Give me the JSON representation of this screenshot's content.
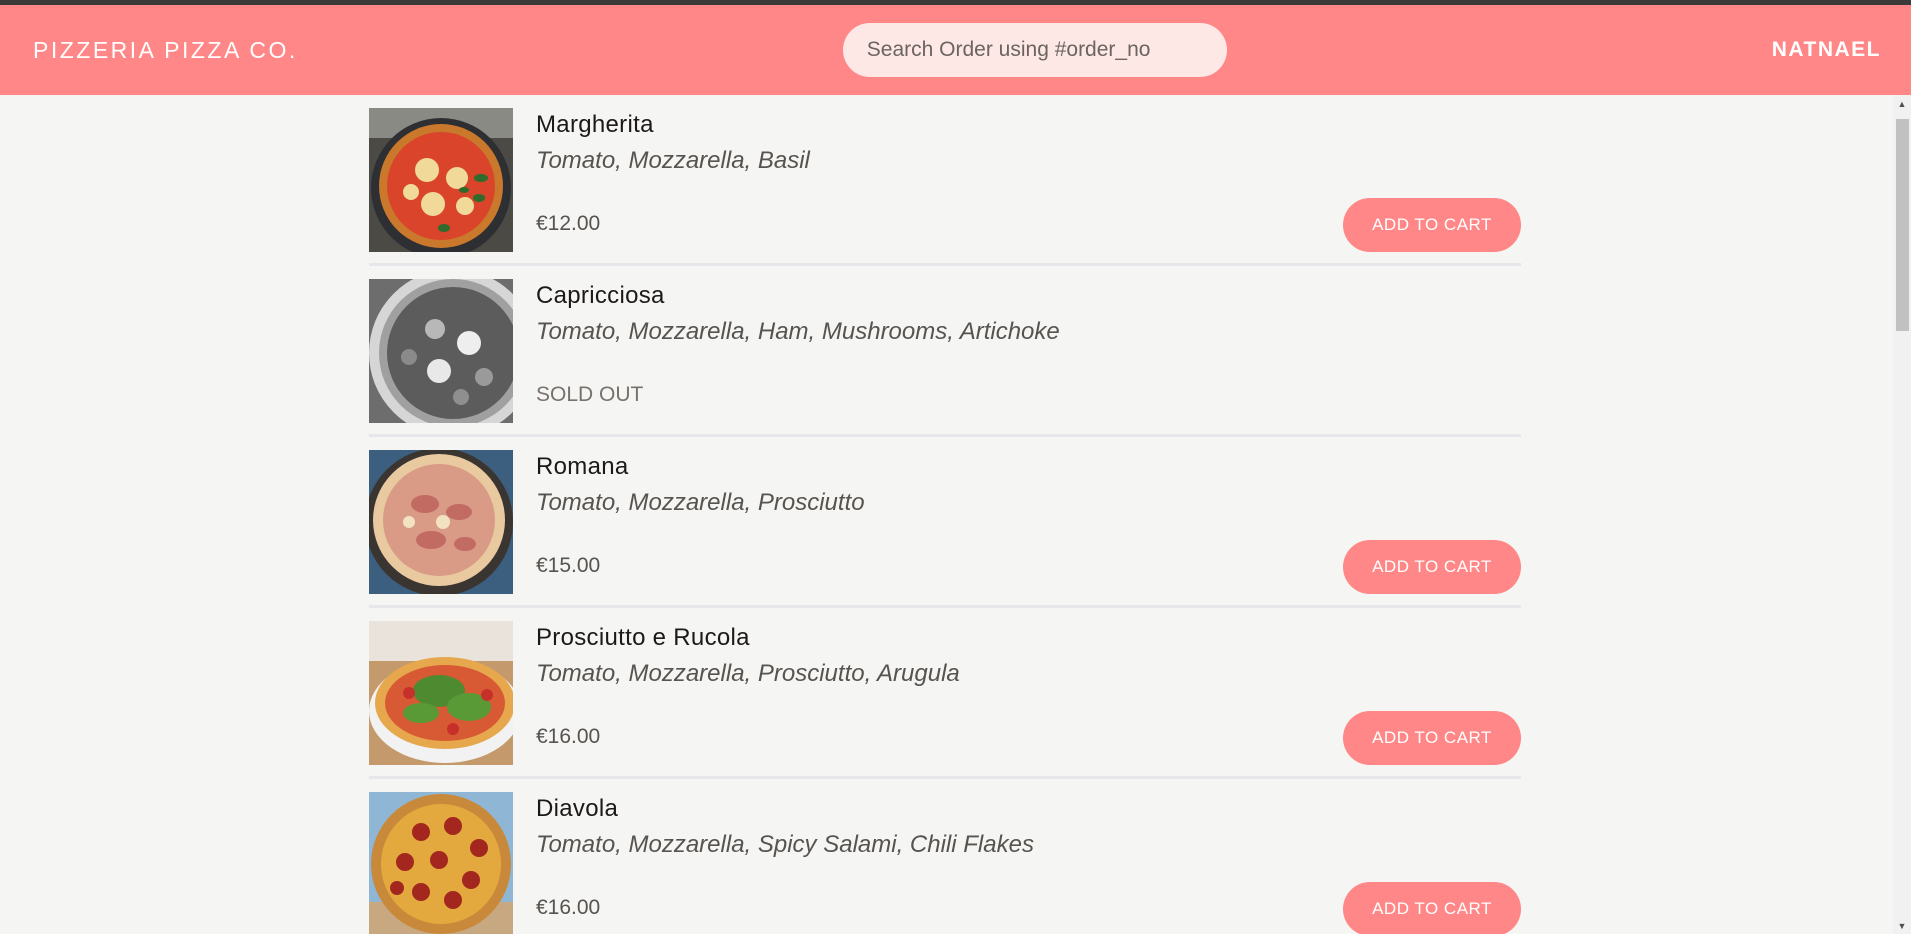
{
  "header": {
    "brand": "PIZZERIA PIZZA CO.",
    "search_placeholder": "Search Order using #order_no",
    "username": "NATNAEL",
    "background_color": "#ff8787"
  },
  "menu": {
    "items": [
      {
        "name": "Margherita",
        "ingredients": "Tomato, Mozzarella, Basil",
        "price": "€12.00",
        "sold_out": false,
        "button": "ADD TO CART"
      },
      {
        "name": "Capricciosa",
        "ingredients": "Tomato, Mozzarella, Ham, Mushrooms, Artichoke",
        "status": "SOLD OUT",
        "sold_out": true
      },
      {
        "name": "Romana",
        "ingredients": "Tomato, Mozzarella, Prosciutto",
        "price": "€15.00",
        "sold_out": false,
        "button": "ADD TO CART"
      },
      {
        "name": "Prosciutto e Rucola",
        "ingredients": "Tomato, Mozzarella, Prosciutto, Arugula",
        "price": "€16.00",
        "sold_out": false,
        "button": "ADD TO CART"
      },
      {
        "name": "Diavola",
        "ingredients": "Tomato, Mozzarella, Spicy Salami, Chili Flakes",
        "price": "€16.00",
        "sold_out": false,
        "button": "ADD TO CART"
      }
    ]
  },
  "colors": {
    "accent": "#ff8787",
    "page_background": "#f5f5f4",
    "divider": "#e5e7eb"
  }
}
